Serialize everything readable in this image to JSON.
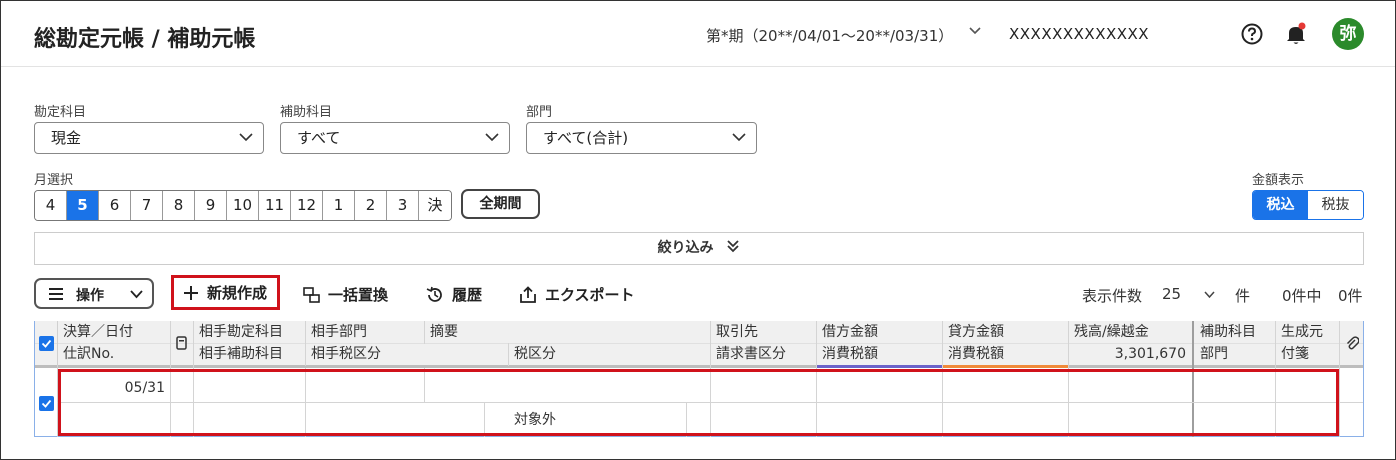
{
  "header": {
    "title": "総勘定元帳 / 補助元帳",
    "period": "第*期（20**/04/01〜20**/03/31）",
    "company": "XXXXXXXXXXXXX",
    "avatar_text": "弥"
  },
  "filters": {
    "account_label": "勘定科目",
    "account_value": "現金",
    "sub_account_label": "補助科目",
    "sub_account_value": "すべて",
    "department_label": "部門",
    "department_value": "すべて(合計)"
  },
  "month_selector": {
    "label": "月選択",
    "months": [
      "4",
      "5",
      "6",
      "7",
      "8",
      "9",
      "10",
      "11",
      "12",
      "1",
      "2",
      "3",
      "決"
    ],
    "selected": "5",
    "all_period_label": "全期間"
  },
  "amount_display": {
    "label": "金額表示",
    "options": [
      "税込",
      "税抜"
    ],
    "selected": "税込"
  },
  "narrow_label": "絞り込み",
  "toolbar": {
    "operations_label": "操作",
    "new_label": "新規作成",
    "replace_label": "一括置換",
    "history_label": "履歴",
    "export_label": "エクスポート",
    "page_size_label": "表示件数",
    "page_size_value": "25",
    "page_size_unit": "件",
    "count_label": "0件中",
    "count_value": "0件"
  },
  "table": {
    "headers_row1": {
      "date": "決算／日付",
      "counter_account": "相手勘定科目",
      "counter_dept": "相手部門",
      "summary": "摘要",
      "partner": "取引先",
      "debit": "借方金額",
      "credit": "貸方金額",
      "balance": "残高/繰越金",
      "sub_account": "補助科目",
      "origin": "生成元"
    },
    "headers_row2": {
      "entry_no": "仕訳No.",
      "counter_sub_account": "相手補助科目",
      "counter_tax": "相手税区分",
      "tax_class": "税区分",
      "invoice_class": "請求書区分",
      "debit_tax": "消費税額",
      "credit_tax": "消費税額",
      "balance_value": "3,301,670",
      "department": "部門",
      "note": "付箋"
    },
    "row": {
      "date": "05/31",
      "tax_class": "対象外"
    }
  }
}
